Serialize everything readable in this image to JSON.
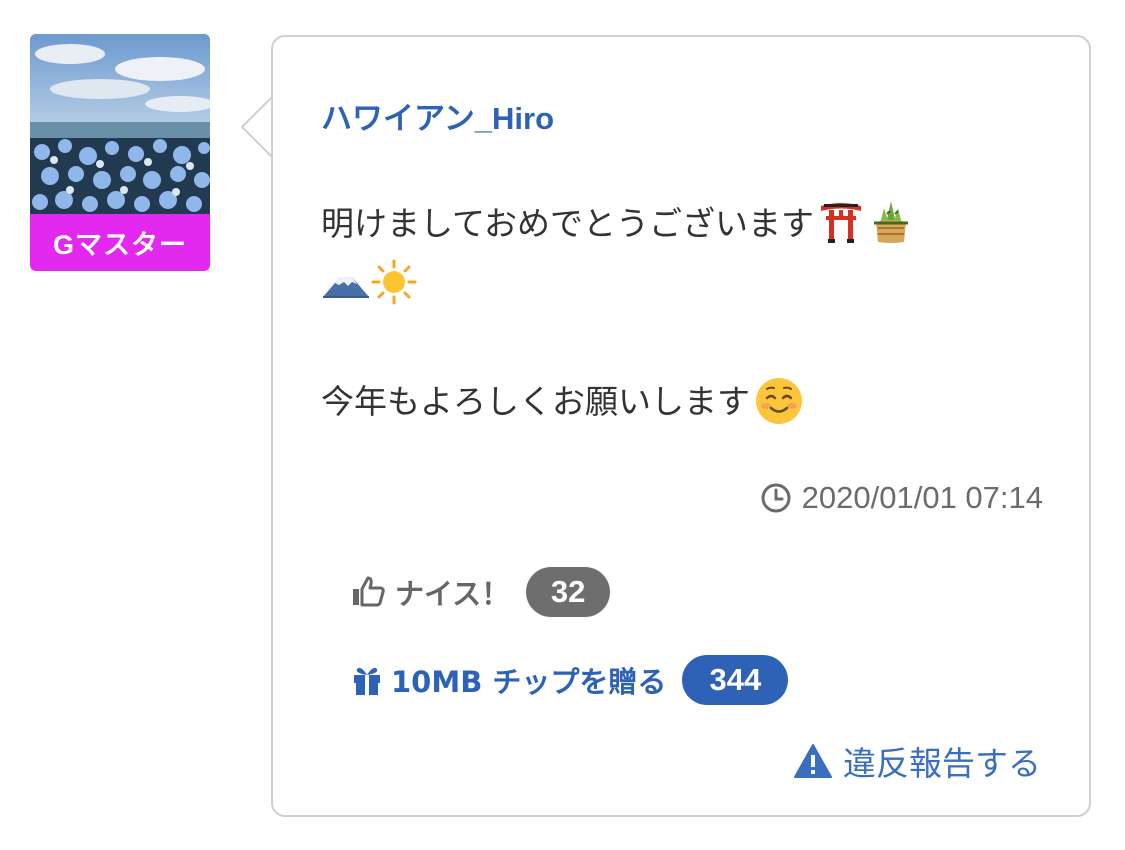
{
  "avatar": {
    "badge_label": "Gマスター",
    "badge_color": "#e328f0"
  },
  "post": {
    "username": "ハワイアン_Hiro",
    "message_line1": "明けましておめでとうございます",
    "message_line3": "今年もよろしくお願いします",
    "emojis": [
      "torii-icon",
      "kadomatsu-icon",
      "mount-fuji-icon",
      "sun-icon",
      "smiling-face-icon"
    ],
    "timestamp": "2020/01/01 07:14"
  },
  "actions": {
    "nice_label": "ナイス！",
    "nice_count": "32",
    "tip_label": "10MB チップを贈る",
    "tip_count": "344",
    "report_label": "違反報告する"
  },
  "colors": {
    "link_blue": "#2d62b6",
    "badge_gray": "#6e6e6e",
    "border": "#cfcfcf"
  }
}
